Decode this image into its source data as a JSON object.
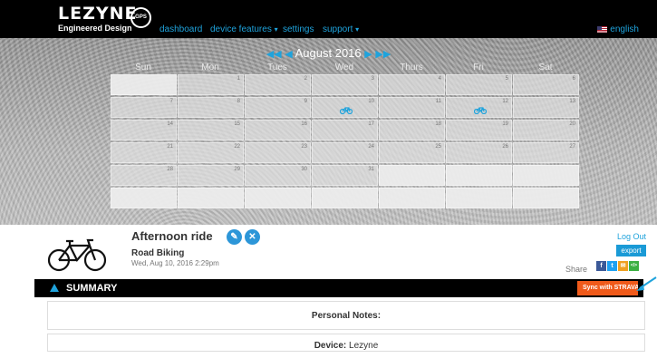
{
  "header": {
    "brand": "LEZYNE",
    "tagline": "Engineered Design",
    "badge": "GPS",
    "nav": [
      {
        "label": "dashboard",
        "caret": ""
      },
      {
        "label": "device features",
        "caret": "▾"
      },
      {
        "label": "settings",
        "caret": ""
      },
      {
        "label": "support",
        "caret": "▾"
      }
    ],
    "language": "english"
  },
  "calendar": {
    "month_title": "August 2016",
    "nav_first": "◀◀",
    "nav_prev": "◀",
    "nav_next": "▶",
    "nav_last": "▶▶",
    "weekdays": [
      "Sun",
      "Mon",
      "Tues",
      "Wed",
      "Thurs",
      "Fri",
      "Sat"
    ],
    "weeks": [
      [
        "",
        "1",
        "2",
        "3",
        "4",
        "5",
        "6"
      ],
      [
        "7",
        "8",
        "9",
        "10",
        "11",
        "12",
        "13"
      ],
      [
        "14",
        "15",
        "16",
        "17",
        "18",
        "19",
        "20"
      ],
      [
        "21",
        "22",
        "23",
        "24",
        "25",
        "26",
        "27"
      ],
      [
        "28",
        "29",
        "30",
        "31",
        "",
        "",
        ""
      ],
      [
        "",
        "",
        "",
        "",
        "",
        "",
        ""
      ]
    ],
    "activity_days": [
      "10",
      "12"
    ]
  },
  "activity": {
    "title": "Afternoon ride",
    "edit_icon": "pencil-icon",
    "delete_icon": "close-icon",
    "type": "Road Biking",
    "date": "Wed, Aug 10, 2016 2:29pm"
  },
  "account": {
    "logout": "Log Out",
    "export": "export",
    "share_label": "Share",
    "share_icons": [
      {
        "name": "facebook-icon",
        "glyph": "f",
        "color": "#3b5998"
      },
      {
        "name": "twitter-icon",
        "glyph": "t",
        "color": "#1da1f2"
      },
      {
        "name": "email-icon",
        "glyph": "✉",
        "color": "#f0a020"
      },
      {
        "name": "embed-icon",
        "glyph": "</>",
        "color": "#3cb043"
      }
    ]
  },
  "summary": {
    "label": "SUMMARY",
    "strava_button": "Sync with STRAVA",
    "notes_label": "Personal Notes:",
    "device_label": "Device:",
    "device_value": "Lezyne"
  },
  "colors": {
    "accent": "#1fa3dc",
    "strava": "#f05a1a"
  }
}
